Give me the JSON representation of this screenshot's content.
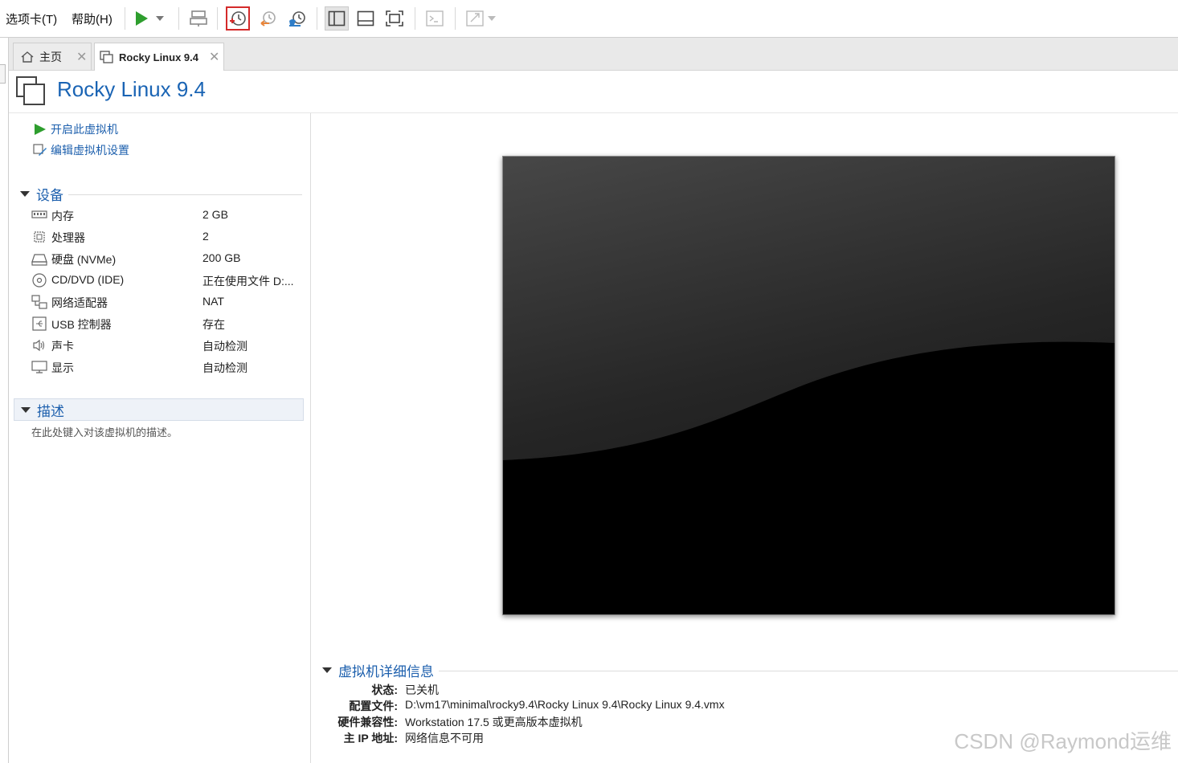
{
  "menu": {
    "tabs_menu": "选项卡(T)",
    "help_menu": "帮助(H)"
  },
  "tabs": [
    {
      "label": "主页",
      "active": false
    },
    {
      "label": "Rocky Linux 9.4",
      "active": true
    }
  ],
  "vm": {
    "title": "Rocky Linux 9.4",
    "actions": {
      "power_on": "开启此虚拟机",
      "edit_settings": "编辑虚拟机设置"
    }
  },
  "devices": {
    "section_label": "设备",
    "items": [
      {
        "name": "内存",
        "value": "2 GB",
        "icon": "memory-icon"
      },
      {
        "name": "处理器",
        "value": "2",
        "icon": "cpu-icon"
      },
      {
        "name": "硬盘 (NVMe)",
        "value": "200 GB",
        "icon": "harddisk-icon"
      },
      {
        "name": "CD/DVD (IDE)",
        "value": "正在使用文件 D:...",
        "icon": "cd-dvd-icon"
      },
      {
        "name": "网络适配器",
        "value": "NAT",
        "icon": "network-icon"
      },
      {
        "name": "USB 控制器",
        "value": "存在",
        "icon": "usb-icon"
      },
      {
        "name": "声卡",
        "value": "自动检测",
        "icon": "speaker-icon"
      },
      {
        "name": "显示",
        "value": "自动检测",
        "icon": "monitor-icon"
      }
    ]
  },
  "description": {
    "section_label": "描述",
    "placeholder": "在此处键入对该虚拟机的描述。"
  },
  "details": {
    "section_label": "虚拟机详细信息",
    "rows": [
      {
        "key": "状态:",
        "value": "已关机"
      },
      {
        "key": "配置文件:",
        "value": "D:\\vm17\\minimal\\rocky9.4\\Rocky Linux 9.4\\Rocky Linux 9.4.vmx"
      },
      {
        "key": "硬件兼容性:",
        "value": "Workstation 17.5 或更高版本虚拟机"
      },
      {
        "key": "主 IP 地址:",
        "value": "网络信息不可用"
      }
    ]
  },
  "watermark": "CSDN @Raymond运维",
  "colors": {
    "accent": "#1a64b4",
    "play_green": "#2e9e2e",
    "highlight_red": "#d42a2a"
  }
}
